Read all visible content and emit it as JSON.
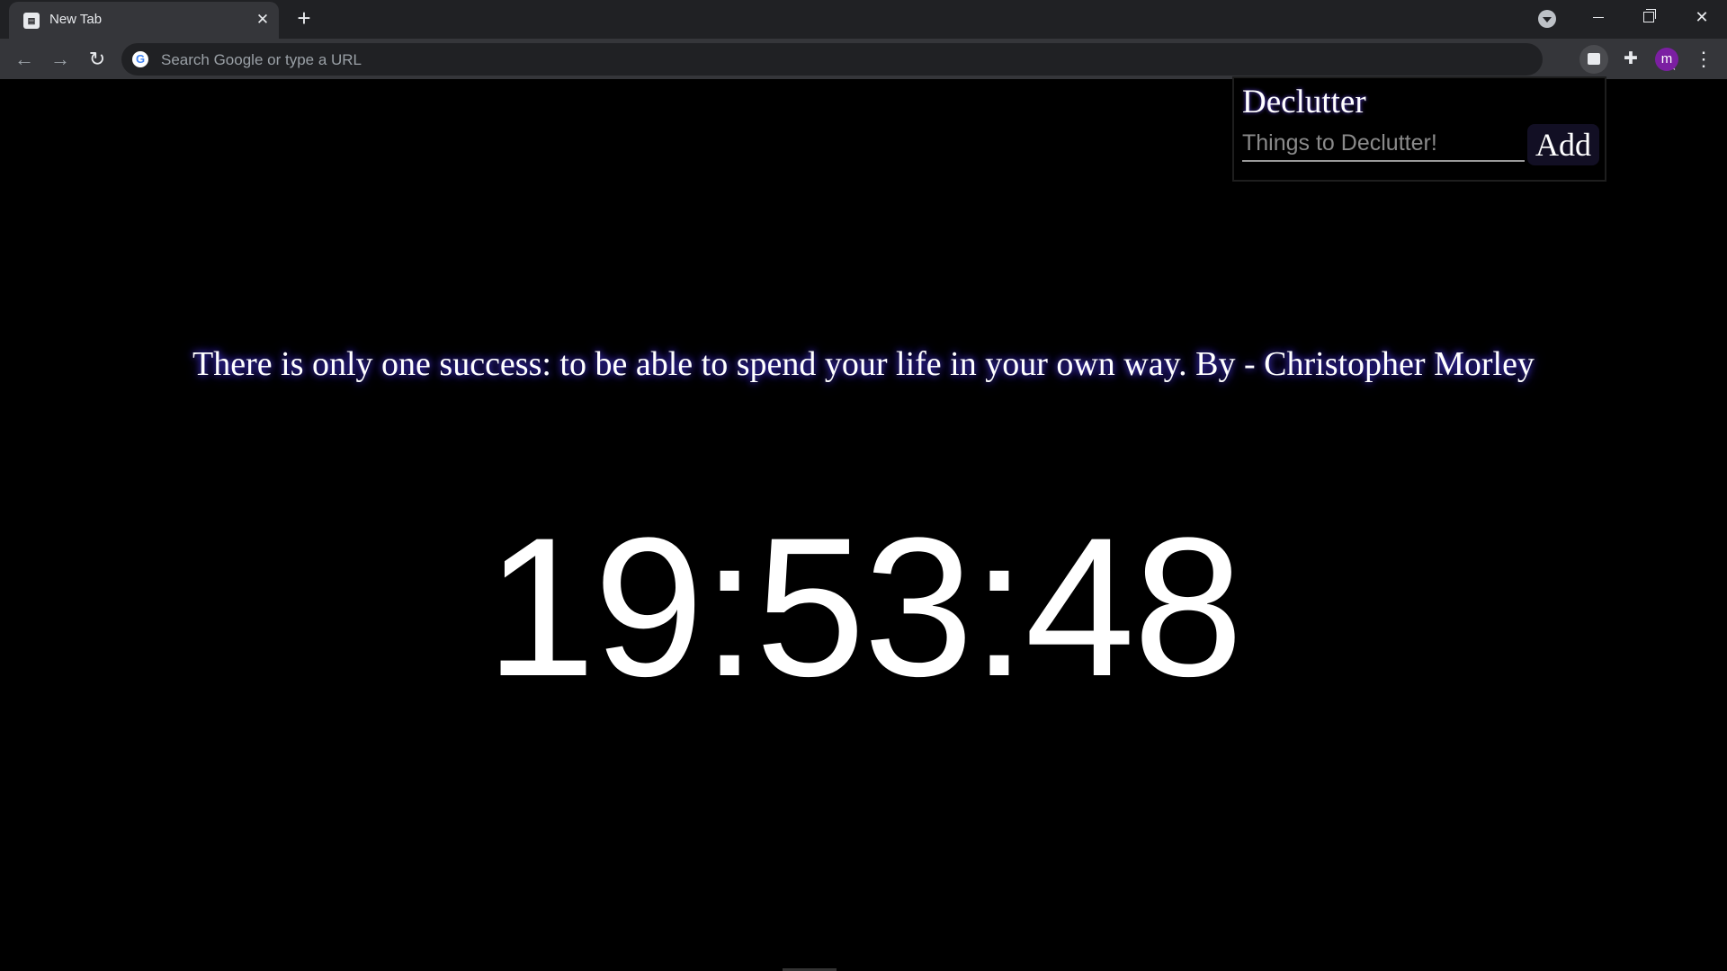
{
  "browser": {
    "tab": {
      "title": "New Tab",
      "favicon": "declutter-favicon"
    },
    "new_tab_label": "+",
    "close_label": "✕",
    "omnibox": {
      "placeholder": "Search Google or type a URL",
      "value": ""
    },
    "profile_initial": "m",
    "icons": {
      "back": "←",
      "forward": "→",
      "reload": "↻",
      "star": "☆",
      "puzzle": "✚",
      "menu": "⋮",
      "google": "G",
      "window_close": "✕"
    }
  },
  "popup": {
    "title": "Declutter",
    "input_placeholder": "Things to Declutter!",
    "input_value": "",
    "add_label": "Add"
  },
  "quote": {
    "text": "There is only one success: to be able to spend your life in your own way. By - Christopher Morley"
  },
  "clock": {
    "hours": "19",
    "minutes": "53",
    "seconds": "48",
    "separator": ":"
  },
  "colors": {
    "background": "#000000",
    "glow": "#4a3be0",
    "avatar": "#7b1fa2"
  }
}
